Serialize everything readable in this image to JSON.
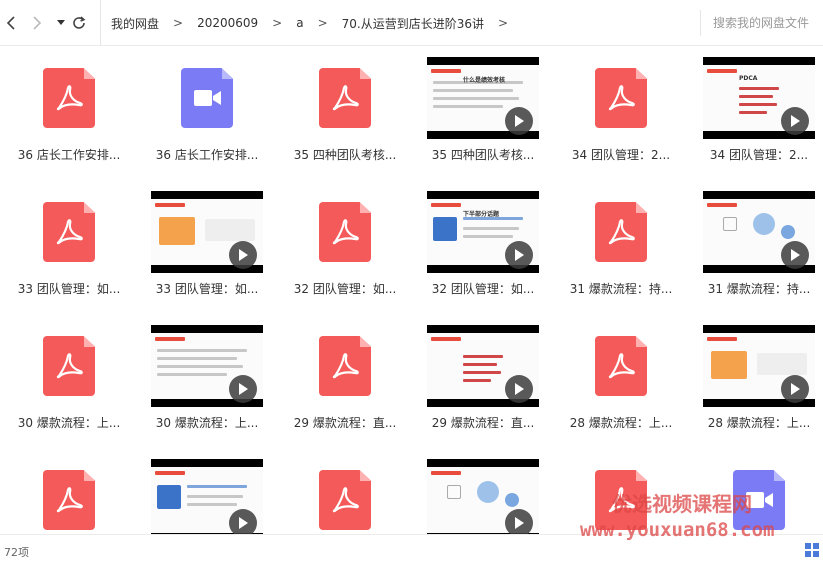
{
  "nav": {
    "back_icon": "chevron-left-icon",
    "forward_icon": "chevron-right-icon",
    "history_icon": "caret-down-icon",
    "refresh_icon": "refresh-icon"
  },
  "breadcrumb": {
    "items": [
      "我的网盘",
      "20200609",
      "a",
      "70.从运营到店长进阶36讲"
    ],
    "separator": ">"
  },
  "search": {
    "placeholder": "搜索我的网盘文件"
  },
  "files": [
    {
      "type": "pdf",
      "label": "36 店长工作安排..."
    },
    {
      "type": "video-file",
      "label": "36 店长工作安排..."
    },
    {
      "type": "pdf",
      "label": "35 四种团队考核..."
    },
    {
      "type": "video-thumb",
      "label": "35 四种团队考核...",
      "thumb_title": "什么是绩效考核"
    },
    {
      "type": "pdf",
      "label": "34 团队管理：2..."
    },
    {
      "type": "video-thumb",
      "label": "34 团队管理：2...",
      "thumb_title": "PDCA"
    },
    {
      "type": "pdf",
      "label": "33 团队管理：如..."
    },
    {
      "type": "video-thumb",
      "label": "33 团队管理：如..."
    },
    {
      "type": "pdf",
      "label": "32 团队管理：如..."
    },
    {
      "type": "video-thumb",
      "label": "32 团队管理：如...",
      "thumb_title": "下半部分话题"
    },
    {
      "type": "pdf",
      "label": "31 爆款流程：持..."
    },
    {
      "type": "video-thumb",
      "label": "31 爆款流程：持..."
    },
    {
      "type": "pdf",
      "label": "30 爆款流程：上..."
    },
    {
      "type": "video-thumb",
      "label": "30 爆款流程：上..."
    },
    {
      "type": "pdf",
      "label": "29 爆款流程：直..."
    },
    {
      "type": "video-thumb",
      "label": "29 爆款流程：直..."
    },
    {
      "type": "pdf",
      "label": "28 爆款流程：上..."
    },
    {
      "type": "video-thumb",
      "label": "28 爆款流程：上..."
    },
    {
      "type": "pdf",
      "label": ""
    },
    {
      "type": "video-thumb",
      "label": ""
    },
    {
      "type": "pdf",
      "label": ""
    },
    {
      "type": "video-thumb",
      "label": ""
    },
    {
      "type": "pdf",
      "label": ""
    },
    {
      "type": "video-file",
      "label": ""
    }
  ],
  "status": {
    "count": "72项"
  },
  "watermark": {
    "line1": "优选视频课程网",
    "line2": "www.youxuan68.com"
  },
  "colors": {
    "pdf": "#f55a5a",
    "video_file": "#7b7cf5",
    "watermark": "#dc4646"
  }
}
